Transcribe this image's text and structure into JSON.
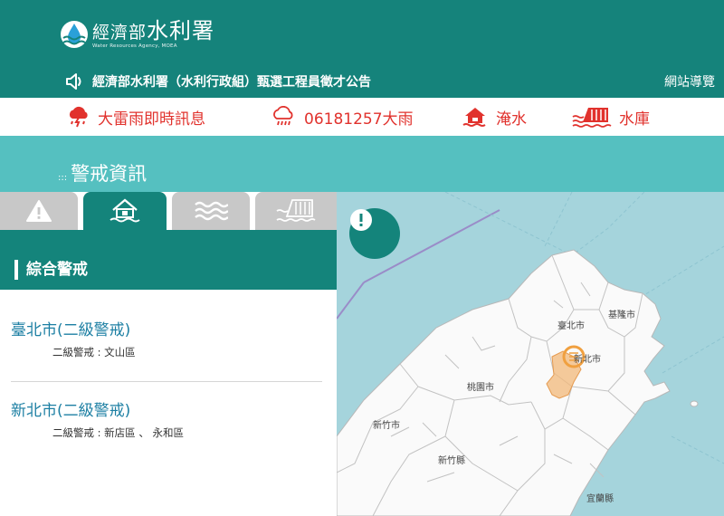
{
  "header": {
    "logo_title_main": "經濟部",
    "logo_title_agency": "水利署",
    "logo_subtitle": "Water Resources Agency, MOEA",
    "announcement": "經濟部水利署（水利行政組）甄選工程員徵才公告",
    "sitemap": "網站導覽"
  },
  "alerts": [
    {
      "icon": "thunderstorm-icon",
      "label": "大雷雨即時訊息"
    },
    {
      "icon": "heavy-rain-icon",
      "label": "06181257大雨"
    },
    {
      "icon": "flood-house-icon",
      "label": "淹水"
    },
    {
      "icon": "reservoir-icon",
      "label": "水庫"
    }
  ],
  "section": {
    "title": "警戒資訊",
    "prefix": ":::"
  },
  "tabs": [
    {
      "icon": "warning-icon",
      "active": false
    },
    {
      "icon": "flood-house-icon",
      "active": true
    },
    {
      "icon": "waves-icon",
      "active": false
    },
    {
      "icon": "reservoir-icon",
      "active": false
    }
  ],
  "panel": {
    "title": "綜合警戒",
    "items": [
      {
        "city": "臺北市(二級警戒)",
        "detail": "二級警戒 : 文山區"
      },
      {
        "city": "新北市(二級警戒)",
        "detail": "二級警戒 : 新店區 、 永和區"
      }
    ]
  },
  "map": {
    "labels": [
      "臺北市",
      "基隆市",
      "新北市",
      "桃園市",
      "新竹市",
      "新竹縣",
      "宜蘭縣"
    ],
    "layer_button_icon": "warning-icon"
  },
  "colors": {
    "header": "#15837b",
    "band": "#55c0c0",
    "alert_red": "#e1322d",
    "city_blue": "#1c7fa3",
    "warning_orange": "#f0a040"
  }
}
